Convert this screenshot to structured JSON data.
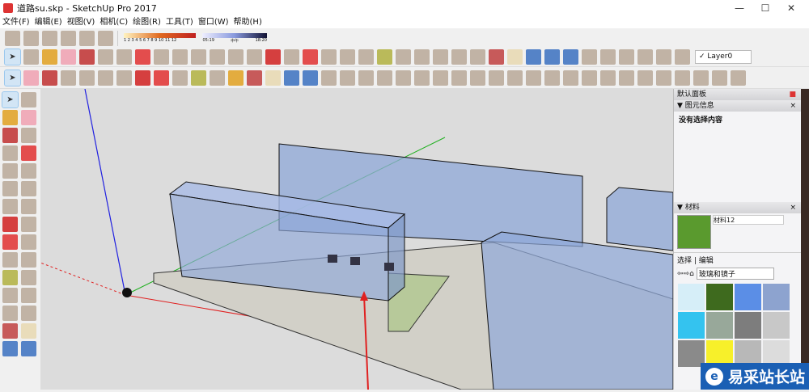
{
  "window": {
    "title": "道路su.skp - SketchUp Pro 2017",
    "minimize": "—",
    "maximize": "☐",
    "close": "✕"
  },
  "menu": [
    "文件(F)",
    "编辑(E)",
    "视图(V)",
    "相机(C)",
    "绘图(R)",
    "工具(T)",
    "窗口(W)",
    "帮助(H)"
  ],
  "toolbar1": {
    "icons": [
      "warehouse-download-icon",
      "share-model-icon",
      "cloud-upload-icon",
      "extension-icon",
      "trimble-connect-icon",
      "shadows-icon"
    ],
    "shadow_months": "1 2 3 4 5 6 7 8 9 10 11 12",
    "time_start": "05:19",
    "time_mid": "中午",
    "time_end": "18:20"
  },
  "toolbar2": {
    "icons": [
      "select-icon",
      "component-icon",
      "paint-bucket-icon",
      "eraser-icon",
      "pencil-icon",
      "freehand-icon",
      "rectangle-icon",
      "rotated-rectangle-icon",
      "circle-icon",
      "polygon-icon",
      "arc-icon",
      "pie-icon",
      "arc3-icon",
      "arc2-icon",
      "move-icon",
      "push-pull-icon",
      "rotate-icon",
      "follow-me-icon",
      "scale-icon",
      "offset-icon",
      "tape-measure-icon",
      "dimension-icon",
      "protractor-icon",
      "text-icon",
      "axes-icon",
      "3d-text-icon",
      "orbit-icon",
      "pan-icon",
      "zoom-icon",
      "zoom-window-icon",
      "zoom-extents-icon",
      "position-camera-icon",
      "look-around-icon",
      "walk-icon",
      "section-plane-icon",
      "display-section-planes-icon",
      "display-section-cuts-icon"
    ],
    "layer": "✓ Layer0"
  },
  "toolbar3": {
    "icons": [
      "select-icon",
      "eraser-icon",
      "pencil-icon",
      "arc-icon",
      "rectangle-icon",
      "push-pull-icon",
      "follow-me-icon",
      "move-icon",
      "rotate-icon",
      "scale-icon",
      "tape-measure-icon",
      "text-icon",
      "paint-bucket-icon",
      "orbit-icon",
      "pan-icon",
      "zoom-icon",
      "zoom-extents-icon",
      "component-icon",
      "warehouse-icon",
      "extension-warehouse-icon",
      "ruby-icon",
      "xray-icon",
      "back-edges-icon",
      "wireframe-icon",
      "hidden-line-icon",
      "shaded-icon",
      "shaded-textures-icon",
      "monochrome-icon",
      "iso-view-icon",
      "top-view-icon",
      "front-view-icon",
      "right-view-icon",
      "back-view-icon",
      "left-view-icon",
      "union-icon",
      "outer-shell-icon",
      "intersect-icon",
      "subtract-icon",
      "trim-icon",
      "split-icon"
    ]
  },
  "lefttoolbar": {
    "icons": [
      "select-icon",
      "component-icon",
      "paint-bucket-icon",
      "eraser-icon",
      "pencil-icon",
      "freehand-icon",
      "rectangle-icon",
      "rotated-rectangle-icon",
      "circle-icon",
      "polygon-icon",
      "arc-icon",
      "arc2-icon",
      "arc3-icon",
      "pie-icon",
      "move-icon",
      "push-pull-icon",
      "rotate-icon",
      "follow-me-icon",
      "scale-icon",
      "offset-icon",
      "tape-measure-icon",
      "text-icon",
      "protractor-icon",
      "axes-icon",
      "dimension-icon",
      "3d-text-icon",
      "orbit-icon",
      "pan-icon",
      "zoom-icon",
      "zoom-window-icon"
    ]
  },
  "panel": {
    "title": "默认面板",
    "entity_info": {
      "header": "▼ 图元信息",
      "status": "没有选择内容"
    },
    "materials": {
      "header": "▼ 材料",
      "name": "材料12",
      "tab_select": "选择",
      "tab_edit": "编辑",
      "library": "玻璃和镜子",
      "swatches": [
        [
          "#d6eef8",
          "#3e6a1e",
          "#5b8ee6",
          "#8da3cf"
        ],
        [
          "#34c3ef",
          "#98a89a",
          "#7d7d7d",
          "#c8c8c8"
        ],
        [
          "#8a8a8a",
          "#f7f02a",
          "#b8b8b8",
          "#dcdcdc"
        ]
      ],
      "current_color": "#5a9a2e"
    }
  },
  "watermark": {
    "text": "易采站长站"
  },
  "colors": {
    "x_axis": "#e02020",
    "y_axis": "#20b020",
    "z_axis": "#2020e0",
    "building": "#8fa8d8"
  }
}
